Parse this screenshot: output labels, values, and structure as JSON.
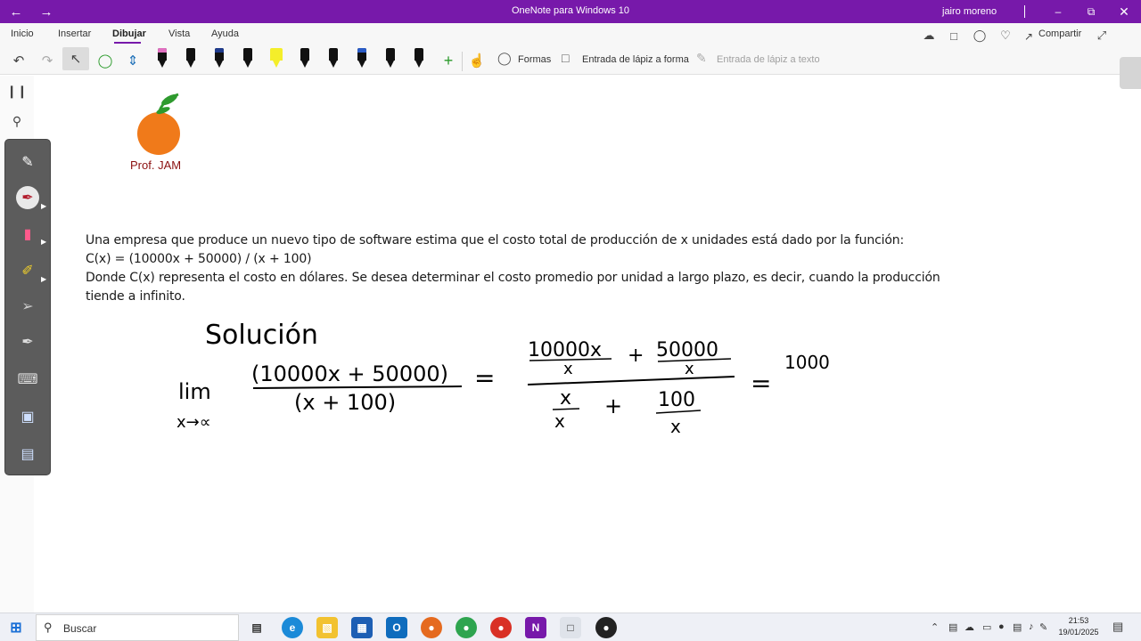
{
  "titlebar": {
    "title": "OneNote para Windows 10",
    "user": "jairo moreno",
    "back_icon": "←",
    "forward_icon": "→"
  },
  "menu": {
    "items": [
      "Inicio",
      "Insertar",
      "Dibujar",
      "Vista",
      "Ayuda"
    ],
    "active": "Dibujar",
    "share_label": "Compartir"
  },
  "ribbon": {
    "shapes_label": "Formas",
    "ink_to_shape_label": "Entrada de lápiz a forma",
    "ink_to_text_label": "Entrada de lápiz a texto",
    "pens": [
      {
        "color": "#e070c0"
      },
      {
        "color": "#111111"
      },
      {
        "color": "#1f3b8c"
      },
      {
        "color": "#111111"
      },
      {
        "color": "#f4ee2a"
      },
      {
        "color": "#111111"
      },
      {
        "color": "#111111"
      },
      {
        "color": "#2b5cc6"
      },
      {
        "color": "#111111"
      },
      {
        "color": "#111111"
      }
    ]
  },
  "logo": {
    "caption": "Prof. JAM",
    "fruit_color": "#f07a1a",
    "leaf_color": "#2e9a2e"
  },
  "problem": {
    "line1": "Una empresa que produce un nuevo tipo de software estima que el costo total de producción de x unidades está dado por la función:",
    "line2": "C(x) = (10000x + 50000) / (x + 100)",
    "line3": "Donde C(x) representa el costo en dólares. Se desea determinar el costo promedio por unidad a largo plazo, es decir, cuando la producción",
    "line4": "tiende a infinito."
  },
  "handwriting": {
    "heading": "Solución",
    "lim": "lim",
    "lim_sub": "x→∝",
    "frac1_num": "(10000x + 50000)",
    "frac1_den": "(x + 100)",
    "eq": "=",
    "frac2_num_a_top": "10000x",
    "frac2_num_a_bot": "x",
    "plus": "+",
    "frac2_num_b_top": "50000",
    "frac2_num_b_bot": "x",
    "frac2_den_a_top": "x",
    "frac2_den_a_bot": "x",
    "frac2_den_b_top": "100",
    "frac2_den_b_bot": "x",
    "result": "1000"
  },
  "taskbar": {
    "search_placeholder": "Buscar",
    "time": "21:53",
    "date": "19/01/2025"
  },
  "colors": {
    "titlebar": "#7719aa",
    "accent": "#7719aa"
  }
}
